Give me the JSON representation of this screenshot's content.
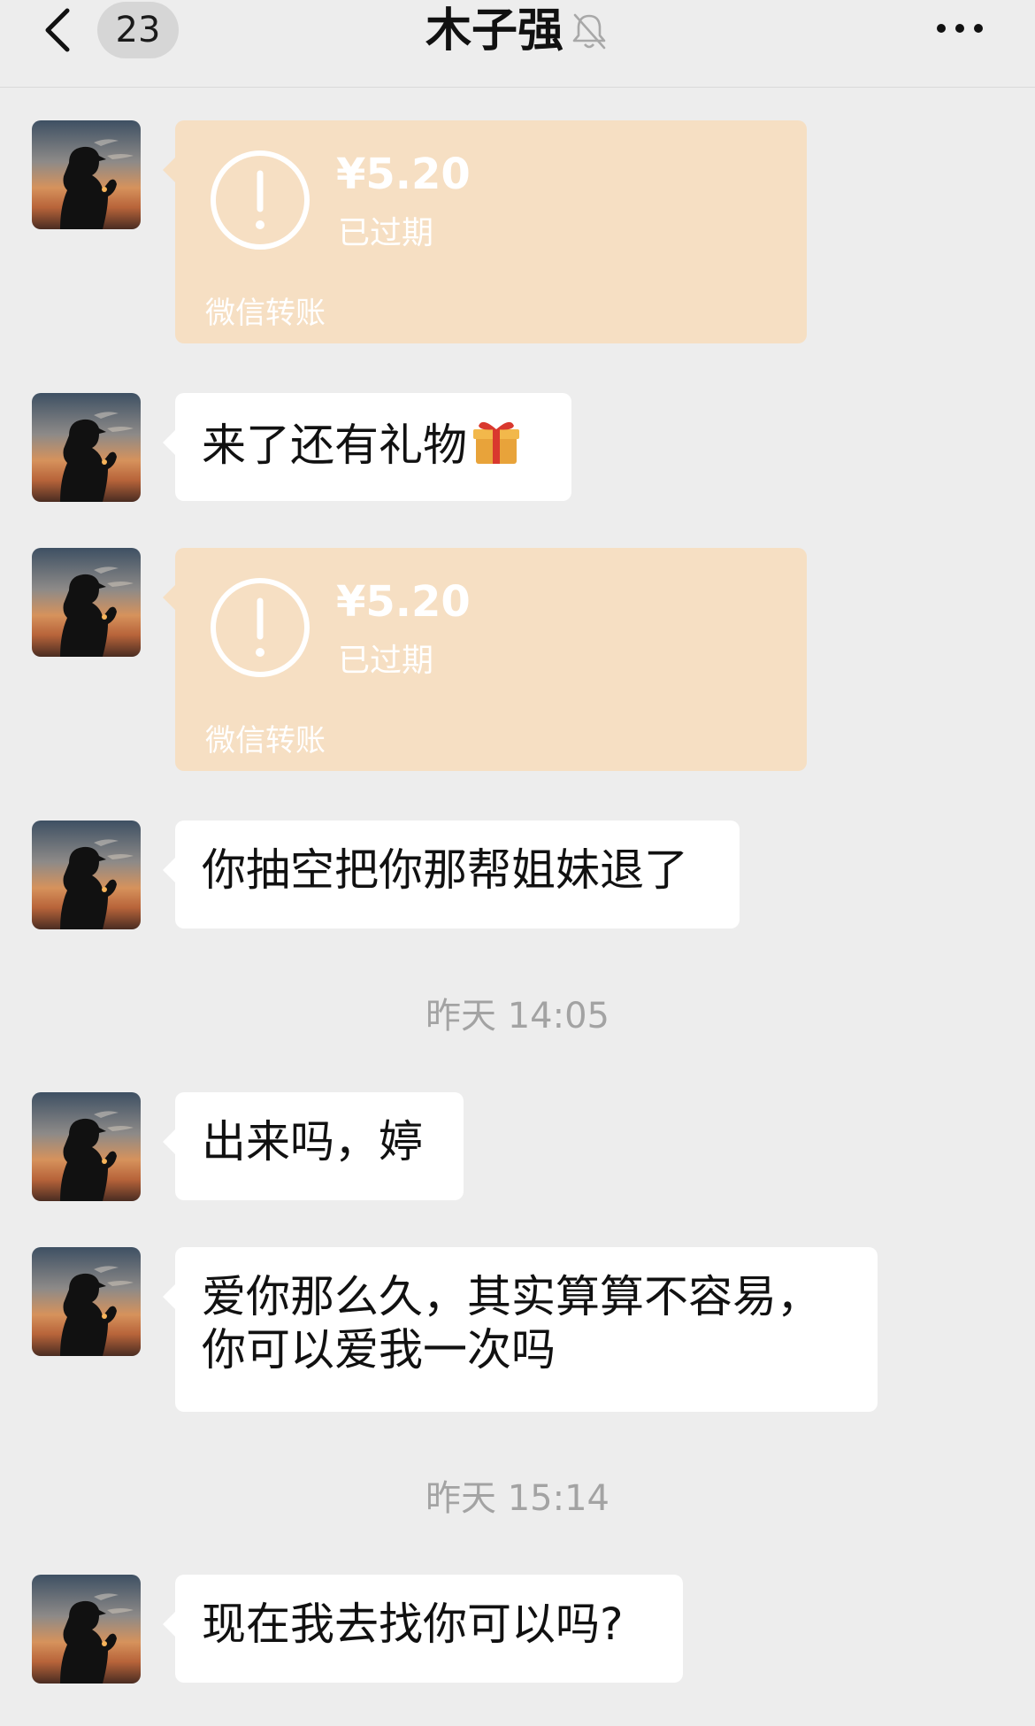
{
  "header": {
    "unread_count": "23",
    "title": "木子强",
    "back_icon": "chevron-left-icon",
    "mute_icon": "bell-off-icon",
    "more_icon": "more-horizontal-icon"
  },
  "messages": [
    {
      "type": "transfer",
      "amount": "¥5.20",
      "status": "已过期",
      "source": "微信转账"
    },
    {
      "type": "text",
      "lines": [
        "来了还有礼物"
      ],
      "emoji": "gift-icon"
    },
    {
      "type": "transfer",
      "amount": "¥5.20",
      "status": "已过期",
      "source": "微信转账"
    },
    {
      "type": "text",
      "lines": [
        "你抽空把你那帮姐妹退了"
      ]
    },
    {
      "type": "time",
      "text": "昨天 14:05"
    },
    {
      "type": "text",
      "lines": [
        "出来吗，婷"
      ]
    },
    {
      "type": "text",
      "lines": [
        "爱你那么久，其实算算不容易，",
        "你可以爱我一次吗"
      ]
    },
    {
      "type": "time",
      "text": "昨天 15:14"
    },
    {
      "type": "text",
      "lines": [
        "现在我去找你可以吗?"
      ]
    }
  ],
  "colors": {
    "background": "#ededed",
    "bubble": "#ffffff",
    "transfer_expired": "#f6dfc3",
    "time_text": "#a3a3a3"
  }
}
